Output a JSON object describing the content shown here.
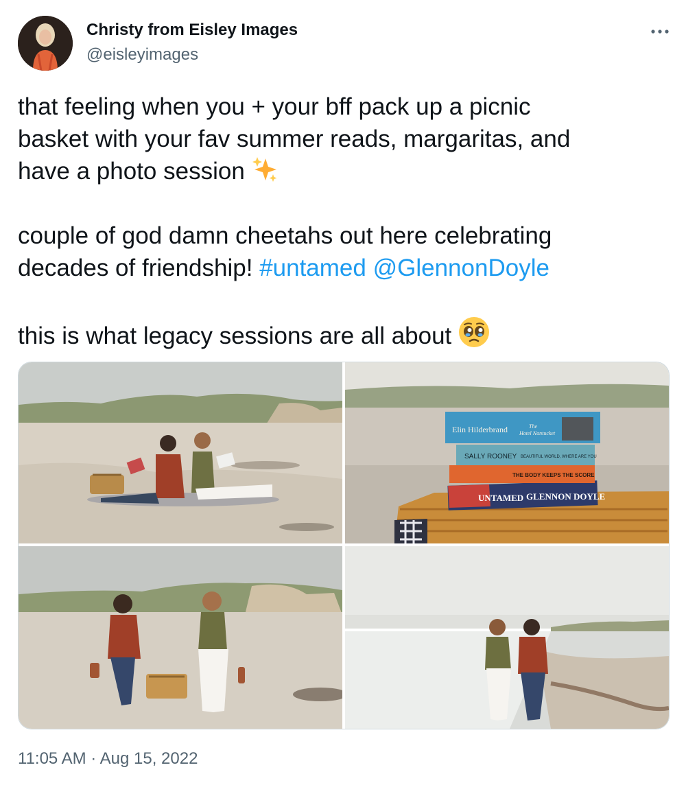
{
  "author": {
    "display_name": "Christy from Eisley Images",
    "handle": "@eisleyimages",
    "avatar_icon": "profile-photo"
  },
  "more_icon": "more-options-icon",
  "body": {
    "line1": "that feeling when you + your bff pack up a picnic",
    "line2": "basket with your fav summer reads, margaritas, and",
    "line3": "have a photo session",
    "line3_emoji": "sparkles",
    "line4": "couple of god damn cheetahs out here celebrating",
    "line5_text": "decades of friendship!",
    "hashtag": "#untamed",
    "mention": "@GlennonDoyle",
    "line6": "this is what legacy sessions are all about",
    "line6_emoji": "pleading-face",
    "link_color": "#1d9bf0"
  },
  "photos": {
    "books": {
      "book1_author": "Elin Hilderbrand",
      "book1_title_a": "The",
      "book1_title_b": "Hotel Nantucket",
      "book2_author": "SALLY ROONEY",
      "book2_title": "BEAUTIFUL WORLD, WHERE ARE YOU",
      "book3_title": "THE BODY KEEPS THE SCORE",
      "book4_title": "UNTAMED",
      "book4_author": "GLENNON DOYLE"
    }
  },
  "timestamp": "11:05 AM · Aug 15, 2022",
  "colors": {
    "text": "#0f1419",
    "secondary": "#536471",
    "border": "#cfd9de"
  }
}
